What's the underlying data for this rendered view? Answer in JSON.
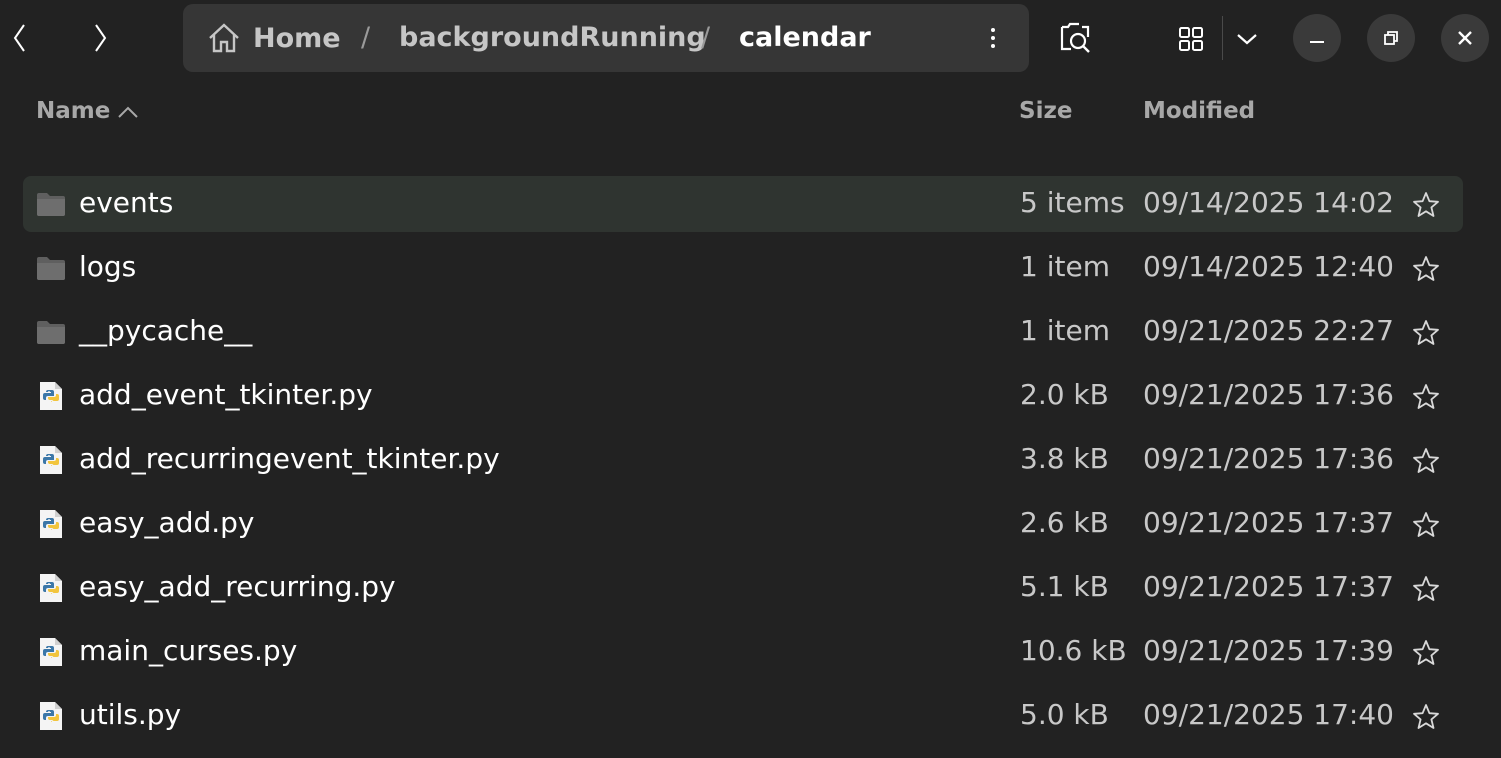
{
  "header": {
    "back_icon": "chevron-left-icon",
    "forward_icon": "chevron-right-icon",
    "breadcrumb": [
      {
        "label": "Home",
        "icon": "home-icon"
      },
      {
        "label": "backgroundRunning"
      },
      {
        "label": "calendar",
        "current": true
      }
    ],
    "separator": "/",
    "path_menu_icon": "vertical-dots-icon",
    "search_icon": "search-icon",
    "view_icon": "grid-view-icon",
    "view_dropdown_icon": "chevron-down-icon",
    "minimize_icon": "minimize-icon",
    "maximize_icon": "restore-icon",
    "close_icon": "close-icon"
  },
  "columns": {
    "name": "Name",
    "size": "Size",
    "modified": "Modified",
    "sort": "ascending"
  },
  "files": [
    {
      "name": "events",
      "type": "folder",
      "size": "5 items",
      "modified": "09/14/2025 14:02",
      "selected": true
    },
    {
      "name": "logs",
      "type": "folder",
      "size": "1 item",
      "modified": "09/14/2025 12:40"
    },
    {
      "name": "__pycache__",
      "type": "folder",
      "size": "1 item",
      "modified": "09/21/2025 22:27"
    },
    {
      "name": "add_event_tkinter.py",
      "type": "python",
      "size": "2.0 kB",
      "modified": "09/21/2025 17:36"
    },
    {
      "name": "add_recurringevent_tkinter.py",
      "type": "python",
      "size": "3.8 kB",
      "modified": "09/21/2025 17:36"
    },
    {
      "name": "easy_add.py",
      "type": "python",
      "size": "2.6 kB",
      "modified": "09/21/2025 17:37"
    },
    {
      "name": "easy_add_recurring.py",
      "type": "python",
      "size": "5.1 kB",
      "modified": "09/21/2025 17:37"
    },
    {
      "name": "main_curses.py",
      "type": "python",
      "size": "10.6 kB",
      "modified": "09/21/2025 17:39"
    },
    {
      "name": "utils.py",
      "type": "python",
      "size": "5.0 kB",
      "modified": "09/21/2025 17:40"
    }
  ],
  "colors": {
    "background": "#222222",
    "pathbar": "#363636",
    "selected_row": "#2f3430",
    "folder": "#6b6b6b"
  }
}
